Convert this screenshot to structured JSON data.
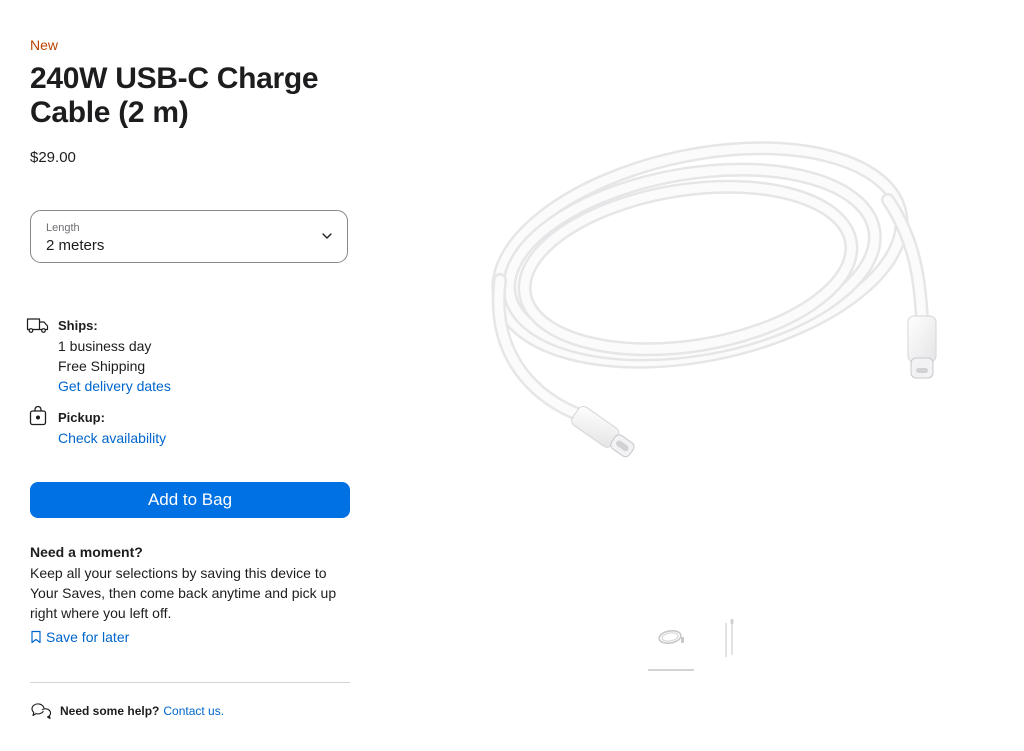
{
  "product": {
    "badge": "New",
    "title": "240W USB-C Charge Cable (2 m)",
    "price": "$29.00",
    "image_icon": "usb-c-cable-image"
  },
  "length_select": {
    "label": "Length",
    "value": "2 meters",
    "icon": "chevron-down-icon"
  },
  "shipping": {
    "icon": "truck-icon",
    "heading": "Ships:",
    "line1": "1 business day",
    "line2": "Free Shipping",
    "link": "Get delivery dates"
  },
  "pickup": {
    "icon": "shopping-bag-icon",
    "heading": "Pickup:",
    "link": "Check availability"
  },
  "add_to_bag": {
    "label": "Add to Bag",
    "color": "#0071e3"
  },
  "moment": {
    "title": "Need a moment?",
    "text": "Keep all your selections by saving this device to Your Saves, then come back anytime and pick up right where you left off.",
    "save_link": "Save for later",
    "save_icon": "bookmark-icon"
  },
  "help": {
    "icon": "chat-bubbles-icon",
    "text": "Need some help?",
    "link": "Contact us."
  },
  "gallery": {
    "thumbnails": [
      {
        "icon": "coiled-cable-thumbnail",
        "active": true
      },
      {
        "icon": "straight-cable-thumbnail",
        "active": false
      }
    ]
  },
  "colors": {
    "accent": "#0071e3",
    "link": "#0066cc",
    "badge": "#b64400",
    "text": "#1d1d1f"
  }
}
